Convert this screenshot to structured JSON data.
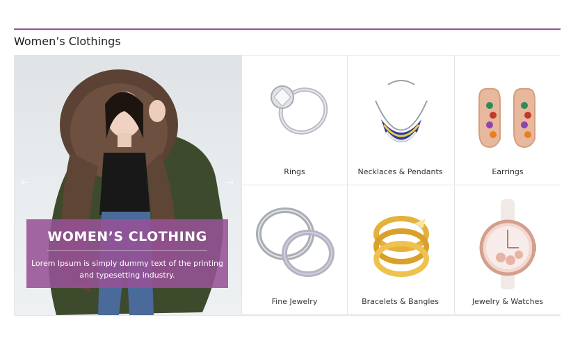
{
  "section": {
    "title": "Women’s Clothings"
  },
  "banner": {
    "heading": "WOMEN’S CLOTHING",
    "description_line1": "Lorem Ipsum is simply dummy text of the printing",
    "description_line2": "and typesetting industry.",
    "prev_icon": "arrow-left-icon",
    "next_icon": "arrow-right-icon",
    "card_color": "#965296"
  },
  "categories": [
    {
      "label": "Rings",
      "icon": "ring-icon"
    },
    {
      "label": "Necklaces & Pendants",
      "icon": "necklace-icon"
    },
    {
      "label": "Earrings",
      "icon": "earrings-icon"
    },
    {
      "label": "Fine Jewelry",
      "icon": "fine-jewelry-icon"
    },
    {
      "label": "Bracelets & Bangles",
      "icon": "bracelet-icon"
    },
    {
      "label": "Jewelry & Watches",
      "icon": "watch-icon"
    }
  ],
  "colors": {
    "accent": "#9b4d96"
  }
}
